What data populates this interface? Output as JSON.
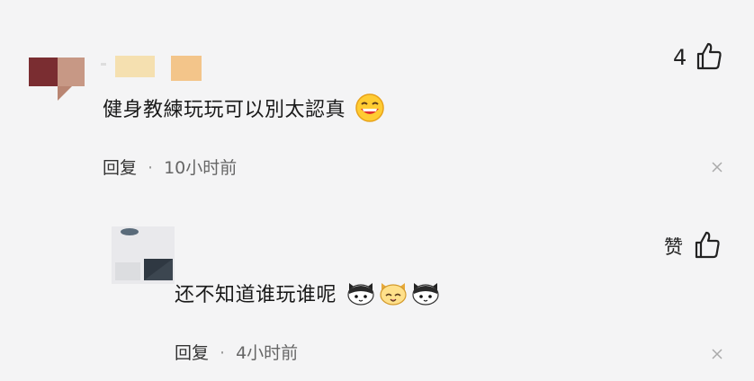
{
  "comments": [
    {
      "text": "健身教練玩玩可以別太認真",
      "emoji": "grinning-face-emoji",
      "like_label": "4",
      "reply_label": "回复",
      "separator": "·",
      "time": "10小时前"
    },
    {
      "text": "还不知道谁玩谁呢",
      "emoji": "cat-face-emoji",
      "like_label": "赞",
      "reply_label": "回复",
      "separator": "·",
      "time": "4小时前"
    }
  ],
  "icons": {
    "like": "thumbs-up-icon",
    "close": "close-icon"
  },
  "colors": {
    "background": "#f4f4f5",
    "text": "#1a1a1a",
    "muted": "#666666"
  }
}
